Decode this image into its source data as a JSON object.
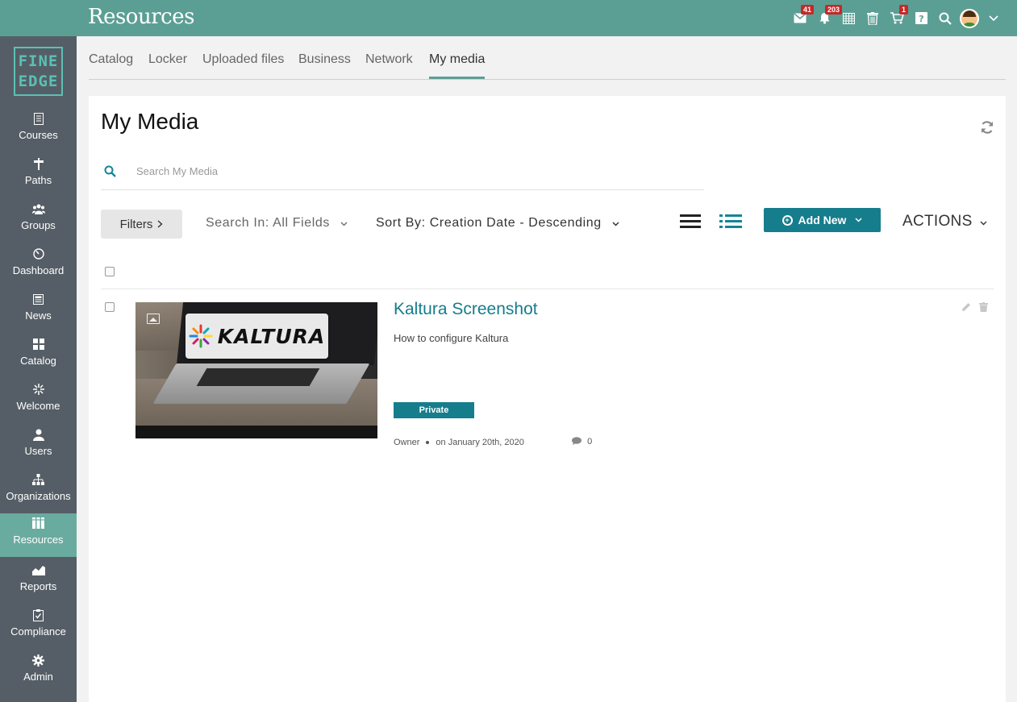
{
  "header": {
    "title": "Resources",
    "icons": [
      {
        "name": "messages",
        "badge": "41"
      },
      {
        "name": "notifications",
        "badge": "203"
      },
      {
        "name": "calendar",
        "badge": ""
      },
      {
        "name": "trash",
        "badge": ""
      },
      {
        "name": "cart",
        "badge": "1"
      },
      {
        "name": "help",
        "badge": ""
      },
      {
        "name": "search",
        "badge": ""
      }
    ]
  },
  "logo": {
    "line1": "FINE",
    "line2": "EDGE"
  },
  "sidebar": {
    "items": [
      {
        "label": "Courses",
        "icon": "book"
      },
      {
        "label": "Paths",
        "icon": "signpost"
      },
      {
        "label": "Groups",
        "icon": "group"
      },
      {
        "label": "Dashboard",
        "icon": "dashboard"
      },
      {
        "label": "News",
        "icon": "newspaper"
      },
      {
        "label": "Catalog",
        "icon": "grid"
      },
      {
        "label": "Welcome",
        "icon": "sparkle"
      },
      {
        "label": "Users",
        "icon": "user"
      },
      {
        "label": "Organizations",
        "icon": "org-chart"
      },
      {
        "label": "Resources",
        "icon": "library",
        "active": true
      },
      {
        "label": "Reports",
        "icon": "chart"
      },
      {
        "label": "Compliance",
        "icon": "checklist"
      },
      {
        "label": "Admin",
        "icon": "gear"
      }
    ]
  },
  "tabs": [
    {
      "label": "Catalog"
    },
    {
      "label": "Locker"
    },
    {
      "label": "Uploaded files"
    },
    {
      "label": "Business"
    },
    {
      "label": "Network"
    },
    {
      "label": "My media",
      "active": true
    }
  ],
  "main": {
    "title": "My Media",
    "search_placeholder": "Search My Media",
    "filters_label": "Filters",
    "search_in": "Search In: All Fields",
    "sort_by": "Sort By: Creation Date - Descending",
    "add_new": "Add New",
    "actions": "ACTIONS"
  },
  "media": [
    {
      "title": "Kaltura Screenshot",
      "description": "How to configure Kaltura",
      "status": "Private",
      "owner": "Owner",
      "date": "on January 20th, 2020",
      "comments": "0",
      "thumb_brand": "KALTURA"
    }
  ],
  "colors": {
    "topbar": "#5b9f94",
    "sidebar": "#555e66",
    "accent": "#157d8c",
    "badge": "#c62828"
  }
}
